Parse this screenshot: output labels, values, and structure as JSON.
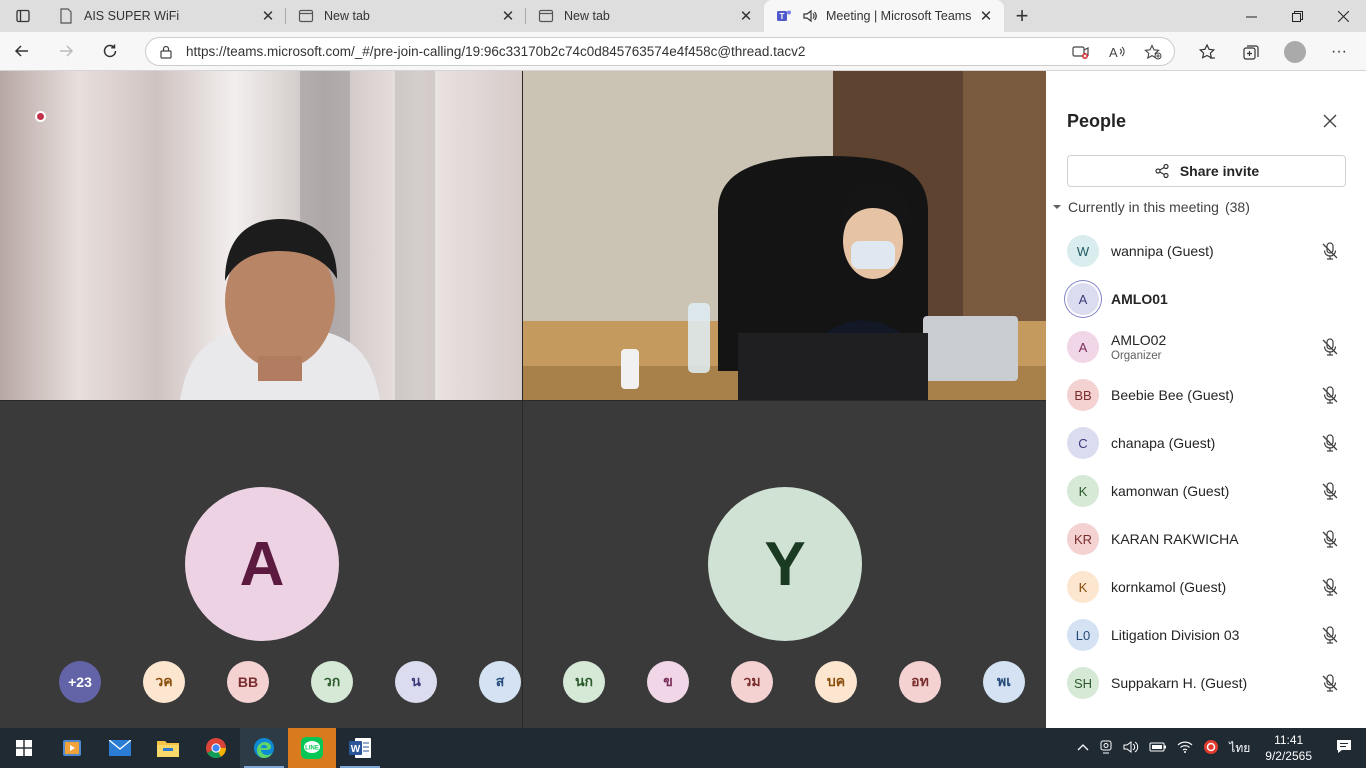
{
  "browser": {
    "tabs": [
      {
        "title": "AIS SUPER WiFi",
        "active": false
      },
      {
        "title": "New tab",
        "active": false
      },
      {
        "title": "New tab",
        "active": false
      },
      {
        "title": "Meeting | Microsoft Teams",
        "active": true
      }
    ],
    "url": "https://teams.microsoft.com/_#/pre-join-calling/19:96c33170b2c74c0d845763574e4f458c@thread.tacv2"
  },
  "stage": {
    "big_avatars": [
      {
        "initial": "A",
        "bg": "#ecd2e3",
        "fg": "#5c1a40"
      },
      {
        "initial": "Y",
        "bg": "#cfe2d3",
        "fg": "#1a3a22"
      }
    ],
    "overflow": [
      {
        "label": "+23",
        "bg": "#6264a7",
        "fg": "#ffffff"
      },
      {
        "label": "วค",
        "bg": "#fde6cf",
        "fg": "#8a4d0a"
      },
      {
        "label": "BB",
        "bg": "#f4d2d2",
        "fg": "#7a2d2d"
      },
      {
        "label": "วก",
        "bg": "#d6e8d6",
        "fg": "#2c5a2c"
      },
      {
        "label": "น",
        "bg": "#dcdcf0",
        "fg": "#3b3b7a"
      },
      {
        "label": "ส",
        "bg": "#d4e2f3",
        "fg": "#274b7a"
      },
      {
        "label": "นก",
        "bg": "#d6e8d6",
        "fg": "#2c5a2c"
      },
      {
        "label": "ข",
        "bg": "#f0d6e6",
        "fg": "#7a2d5a"
      },
      {
        "label": "วม",
        "bg": "#f4d2d2",
        "fg": "#7a2d2d"
      },
      {
        "label": "บค",
        "bg": "#fde6cf",
        "fg": "#8a4d0a"
      },
      {
        "label": "อท",
        "bg": "#f4d2d2",
        "fg": "#7a2d2d"
      },
      {
        "label": "พเ",
        "bg": "#d4e2f3",
        "fg": "#274b7a"
      }
    ]
  },
  "panel": {
    "title": "People",
    "share_label": "Share invite",
    "section_label": "Currently in this meeting",
    "section_count": "(38)",
    "people": [
      {
        "initials": "W",
        "name": "wannipa (Guest)",
        "sub": "",
        "bg": "#d9ecee",
        "fg": "#1f5a60",
        "muted": true,
        "bold": false,
        "ring": false
      },
      {
        "initials": "A",
        "name": "AMLO01",
        "sub": "",
        "bg": "#dcdcf0",
        "fg": "#3b3b7a",
        "muted": false,
        "bold": true,
        "ring": true
      },
      {
        "initials": "A",
        "name": "AMLO02",
        "sub": "Organizer",
        "bg": "#f0d6e6",
        "fg": "#7a2d5a",
        "muted": true,
        "bold": false,
        "ring": false
      },
      {
        "initials": "BB",
        "name": "Beebie Bee (Guest)",
        "sub": "",
        "bg": "#f4d2d2",
        "fg": "#7a2d2d",
        "muted": true,
        "bold": false,
        "ring": false
      },
      {
        "initials": "C",
        "name": "chanapa (Guest)",
        "sub": "",
        "bg": "#dcdcf0",
        "fg": "#3b3b7a",
        "muted": true,
        "bold": false,
        "ring": false
      },
      {
        "initials": "K",
        "name": "kamonwan (Guest)",
        "sub": "",
        "bg": "#d6e8d6",
        "fg": "#2c5a2c",
        "muted": true,
        "bold": false,
        "ring": false
      },
      {
        "initials": "KR",
        "name": "KARAN RAKWICHA",
        "sub": "",
        "bg": "#f4d2d2",
        "fg": "#7a2d2d",
        "muted": true,
        "bold": false,
        "ring": false
      },
      {
        "initials": "K",
        "name": "kornkamol (Guest)",
        "sub": "",
        "bg": "#fde6cf",
        "fg": "#8a4d0a",
        "muted": true,
        "bold": false,
        "ring": false
      },
      {
        "initials": "L0",
        "name": "Litigation Division 03",
        "sub": "",
        "bg": "#d4e2f3",
        "fg": "#274b7a",
        "muted": true,
        "bold": false,
        "ring": false
      },
      {
        "initials": "SH",
        "name": "Suppakarn H. (Guest)",
        "sub": "",
        "bg": "#d6e8d6",
        "fg": "#2c5a2c",
        "muted": true,
        "bold": false,
        "ring": false
      }
    ]
  },
  "taskbar": {
    "language": "ไทย",
    "time": "11:41",
    "date": "9/2/2565"
  }
}
